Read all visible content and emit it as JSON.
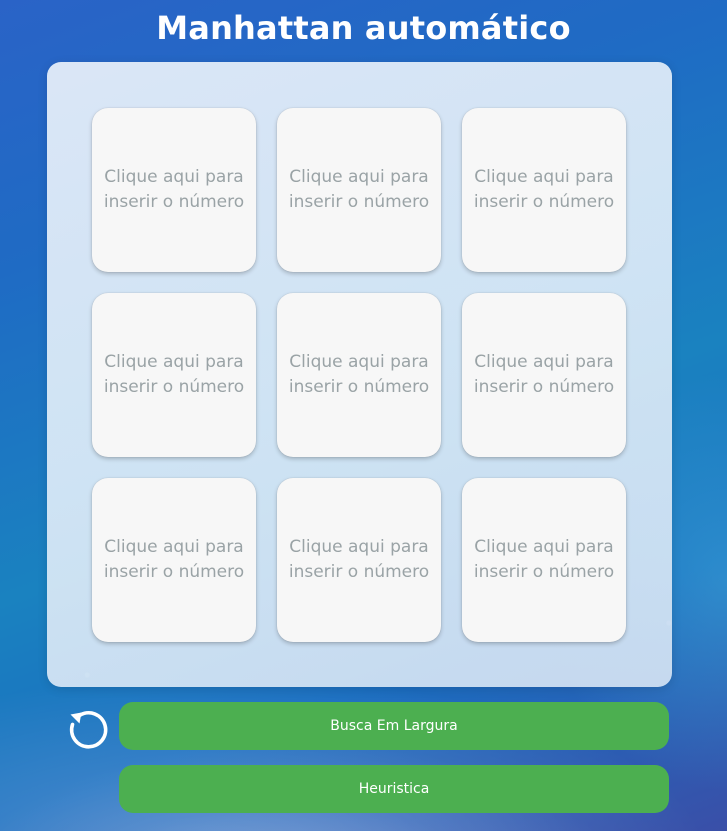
{
  "page": {
    "title": "Manhattan automático"
  },
  "board": {
    "cells": [
      {
        "placeholder": "Clique aqui para inserir o número"
      },
      {
        "placeholder": "Clique aqui para inserir o número"
      },
      {
        "placeholder": "Clique aqui para inserir o número"
      },
      {
        "placeholder": "Clique aqui para inserir o número"
      },
      {
        "placeholder": "Clique aqui para inserir o número"
      },
      {
        "placeholder": "Clique aqui para inserir o número"
      },
      {
        "placeholder": "Clique aqui para inserir o número"
      },
      {
        "placeholder": "Clique aqui para inserir o número"
      },
      {
        "placeholder": "Clique aqui para inserir o número"
      }
    ]
  },
  "controls": {
    "reset_icon": "reset-icon",
    "bfs_label": "Busca Em Largura",
    "heuristic_label": "Heuristica"
  },
  "colors": {
    "button_green": "#4caf50",
    "cell_background": "#f7f7f7",
    "placeholder_text": "#9aa3a6"
  }
}
